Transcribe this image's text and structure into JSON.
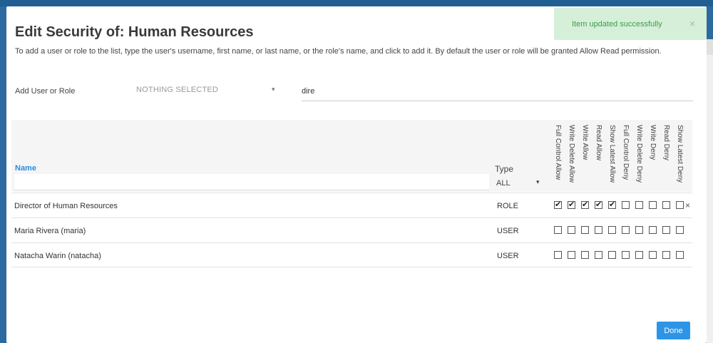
{
  "dialog": {
    "title": "Edit Security of: Human Resources",
    "description": "To add a user or role to the list, type the user's username, first name, or last name, or the role's name, and click to add it. By default the user or role will be granted Allow Read permission.",
    "done_label": "Done"
  },
  "toast": {
    "message": "Item updated successfully",
    "close_glyph": "×"
  },
  "add": {
    "label": "Add User or Role",
    "select_value": "NOTHING SELECTED",
    "select_caret": "▾",
    "search_value": "dire"
  },
  "table": {
    "name_header": "Name",
    "type_header": "Type",
    "type_filter_value": "ALL",
    "type_filter_caret": "▾",
    "permission_columns": [
      "Full Control Allow",
      "Write Delete Allow",
      "Write Allow",
      "Read Allow",
      "Show Latest Allow",
      "Full Control Deny",
      "Write Delete Deny",
      "Write Deny",
      "Read Deny",
      "Show Latest Deny"
    ],
    "rows": [
      {
        "name": "Director of Human Resources",
        "type": "ROLE",
        "permissions": [
          true,
          true,
          true,
          true,
          true,
          false,
          false,
          false,
          false,
          false
        ],
        "remove_glyph": "×"
      },
      {
        "name": "Maria Rivera (maria)",
        "type": "USER",
        "permissions": [
          false,
          false,
          false,
          false,
          false,
          false,
          false,
          false,
          false,
          false
        ]
      },
      {
        "name": "Natacha Warin (natacha)",
        "type": "USER",
        "permissions": [
          false,
          false,
          false,
          false,
          false,
          false,
          false,
          false,
          false,
          false
        ]
      }
    ]
  },
  "colors": {
    "link_blue": "#2d8ce0",
    "done_button": "#2d95e8",
    "toast_bg": "#d6efd9",
    "toast_text": "#3c9c4a",
    "backdrop": "#2d6a9f"
  }
}
